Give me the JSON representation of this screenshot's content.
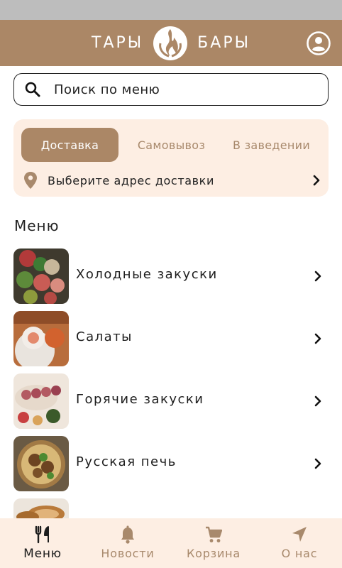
{
  "header": {
    "brand_left": "ТАРЫ",
    "brand_right": "БАРЫ",
    "brand_color": "#ab8766",
    "profile_icon": "account-circle-icon"
  },
  "search": {
    "placeholder": "Поиск по меню",
    "icon": "search-icon"
  },
  "delivery": {
    "modes": [
      "Доставка",
      "Самовывоз",
      "В заведении"
    ],
    "active_mode": "Доставка",
    "address_label": "Выберите адрес доставки",
    "address_icon": "location-pin-icon",
    "background": "#fdeee3"
  },
  "menu": {
    "title": "Меню",
    "categories": [
      {
        "label": "Холодные закуски",
        "photo": "cold-appetizers-photo"
      },
      {
        "label": "Салаты",
        "photo": "salads-photo"
      },
      {
        "label": "Горячие закуски",
        "photo": "hot-appetizers-photo"
      },
      {
        "label": "Русская печь",
        "photo": "russian-oven-photo"
      },
      {
        "label": "",
        "photo": "baked-dish-photo"
      }
    ]
  },
  "tabbar": {
    "tabs": [
      {
        "label": "Меню",
        "icon": "fork-knife-icon",
        "active": true
      },
      {
        "label": "Новости",
        "icon": "bell-icon",
        "active": false
      },
      {
        "label": "Корзина",
        "icon": "cart-icon",
        "active": false
      },
      {
        "label": "О нас",
        "icon": "navigation-arrow-icon",
        "active": false
      }
    ],
    "active_color": "#1d1d1d",
    "inactive_color": "#a8896c"
  }
}
